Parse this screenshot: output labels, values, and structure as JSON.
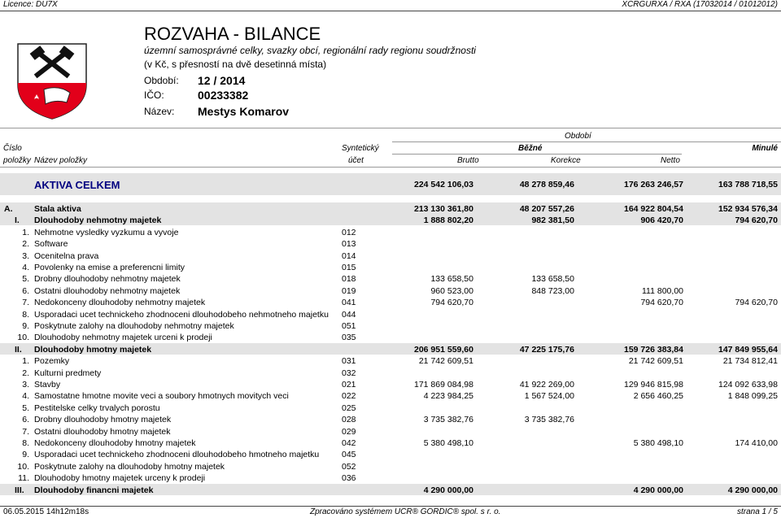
{
  "top": {
    "license": "Licence: DU7X",
    "report_code": "XCRGURXA / RXA (17032014 / 01012012)"
  },
  "header": {
    "title": "ROZVAHA - BILANCE",
    "subtitle": "územní samosprávné celky, svazky obcí, regionální rady regionu soudržnosti",
    "units_note": "(v Kč, s přesností na dvě desetinná místa)",
    "period_label": "Období:",
    "period_value": "12 / 2014",
    "ico_label": "IČO:",
    "ico_value": "00233382",
    "name_label": "Název:",
    "name_value": "Mestys Komarov"
  },
  "columns": {
    "cislo": "Číslo",
    "polozky": "položky",
    "nazev": "Název položky",
    "synteticky": "Syntetický",
    "ucet": "účet",
    "obdobi": "Období",
    "bezne": "Běžné",
    "minule": "Minulé",
    "brutto": "Brutto",
    "korekce": "Korekce",
    "netto": "Netto"
  },
  "total": {
    "label": "AKTIVA CELKEM",
    "brutto": "224 542 106,03",
    "korekce": "48 278 859,46",
    "netto": "176 263 246,57",
    "minule": "163 788 718,55"
  },
  "rows": [
    {
      "num": "A.",
      "name": "Stala aktiva",
      "acct": "",
      "brutto": "213 130 361,80",
      "korekce": "48 207 557,26",
      "netto": "164 922 804,54",
      "minule": "152 934 576,34",
      "bold": true,
      "level": 0
    },
    {
      "num": "I.",
      "name": "Dlouhodoby nehmotny majetek",
      "acct": "",
      "brutto": "1 888 802,20",
      "korekce": "982 381,50",
      "netto": "906 420,70",
      "minule": "794 620,70",
      "bold": true,
      "level": 1
    },
    {
      "num": "1.",
      "name": "Nehmotne vysledky vyzkumu a vyvoje",
      "acct": "012",
      "brutto": "",
      "korekce": "",
      "netto": "",
      "minule": "",
      "bold": false,
      "level": 2
    },
    {
      "num": "2.",
      "name": "Software",
      "acct": "013",
      "brutto": "",
      "korekce": "",
      "netto": "",
      "minule": "",
      "bold": false,
      "level": 2
    },
    {
      "num": "3.",
      "name": "Ocenitelna prava",
      "acct": "014",
      "brutto": "",
      "korekce": "",
      "netto": "",
      "minule": "",
      "bold": false,
      "level": 2
    },
    {
      "num": "4.",
      "name": "Povolenky na emise a preferencni limity",
      "acct": "015",
      "brutto": "",
      "korekce": "",
      "netto": "",
      "minule": "",
      "bold": false,
      "level": 2
    },
    {
      "num": "5.",
      "name": "Drobny dlouhodoby nehmotny majetek",
      "acct": "018",
      "brutto": "133 658,50",
      "korekce": "133 658,50",
      "netto": "",
      "minule": "",
      "bold": false,
      "level": 2
    },
    {
      "num": "6.",
      "name": "Ostatni dlouhodoby nehmotny majetek",
      "acct": "019",
      "brutto": "960 523,00",
      "korekce": "848 723,00",
      "netto": "111 800,00",
      "minule": "",
      "bold": false,
      "level": 2
    },
    {
      "num": "7.",
      "name": "Nedokonceny dlouhodoby nehmotny majetek",
      "acct": "041",
      "brutto": "794 620,70",
      "korekce": "",
      "netto": "794 620,70",
      "minule": "794 620,70",
      "bold": false,
      "level": 2
    },
    {
      "num": "8.",
      "name": "Usporadaci ucet technickeho zhodnoceni dlouhodobeho nehmotneho majetku",
      "acct": "044",
      "brutto": "",
      "korekce": "",
      "netto": "",
      "minule": "",
      "bold": false,
      "level": 2
    },
    {
      "num": "9.",
      "name": "Poskytnute zalohy na dlouhodoby nehmotny majetek",
      "acct": "051",
      "brutto": "",
      "korekce": "",
      "netto": "",
      "minule": "",
      "bold": false,
      "level": 2
    },
    {
      "num": "10.",
      "name": "Dlouhodoby nehmotny majetek urceni k prodeji",
      "acct": "035",
      "brutto": "",
      "korekce": "",
      "netto": "",
      "minule": "",
      "bold": false,
      "level": 2
    },
    {
      "num": "II.",
      "name": "Dlouhodoby hmotny majetek",
      "acct": "",
      "brutto": "206 951 559,60",
      "korekce": "47 225 175,76",
      "netto": "159 726 383,84",
      "minule": "147 849 955,64",
      "bold": true,
      "level": 1
    },
    {
      "num": "1.",
      "name": "Pozemky",
      "acct": "031",
      "brutto": "21 742 609,51",
      "korekce": "",
      "netto": "21 742 609,51",
      "minule": "21 734 812,41",
      "bold": false,
      "level": 2
    },
    {
      "num": "2.",
      "name": "Kulturni predmety",
      "acct": "032",
      "brutto": "",
      "korekce": "",
      "netto": "",
      "minule": "",
      "bold": false,
      "level": 2
    },
    {
      "num": "3.",
      "name": "Stavby",
      "acct": "021",
      "brutto": "171 869 084,98",
      "korekce": "41 922 269,00",
      "netto": "129 946 815,98",
      "minule": "124 092 633,98",
      "bold": false,
      "level": 2
    },
    {
      "num": "4.",
      "name": "Samostatne hmotne movite veci a soubory hmotnych movitych veci",
      "acct": "022",
      "brutto": "4 223 984,25",
      "korekce": "1 567 524,00",
      "netto": "2 656 460,25",
      "minule": "1 848 099,25",
      "bold": false,
      "level": 2
    },
    {
      "num": "5.",
      "name": "Pestitelske celky trvalych porostu",
      "acct": "025",
      "brutto": "",
      "korekce": "",
      "netto": "",
      "minule": "",
      "bold": false,
      "level": 2
    },
    {
      "num": "6.",
      "name": "Drobny dlouhodoby hmotny majetek",
      "acct": "028",
      "brutto": "3 735 382,76",
      "korekce": "3 735 382,76",
      "netto": "",
      "minule": "",
      "bold": false,
      "level": 2
    },
    {
      "num": "7.",
      "name": "Ostatni dlouhodoby hmotny majetek",
      "acct": "029",
      "brutto": "",
      "korekce": "",
      "netto": "",
      "minule": "",
      "bold": false,
      "level": 2
    },
    {
      "num": "8.",
      "name": "Nedokonceny dlouhodoby hmotny majetek",
      "acct": "042",
      "brutto": "5 380 498,10",
      "korekce": "",
      "netto": "5 380 498,10",
      "minule": "174 410,00",
      "bold": false,
      "level": 2
    },
    {
      "num": "9.",
      "name": "Usporadaci ucet technickeho zhodnoceni dlouhodobeho hmotneho majetku",
      "acct": "045",
      "brutto": "",
      "korekce": "",
      "netto": "",
      "minule": "",
      "bold": false,
      "level": 2
    },
    {
      "num": "10.",
      "name": "Poskytnute zalohy na dlouhodoby hmotny majetek",
      "acct": "052",
      "brutto": "",
      "korekce": "",
      "netto": "",
      "minule": "",
      "bold": false,
      "level": 2
    },
    {
      "num": "11.",
      "name": "Dlouhodoby hmotny majetek urceny k prodeji",
      "acct": "036",
      "brutto": "",
      "korekce": "",
      "netto": "",
      "minule": "",
      "bold": false,
      "level": 2
    },
    {
      "num": "III.",
      "name": "Dlouhodoby financni majetek",
      "acct": "",
      "brutto": "4 290 000,00",
      "korekce": "",
      "netto": "4 290 000,00",
      "minule": "4 290 000,00",
      "bold": true,
      "level": 1
    }
  ],
  "footer": {
    "timestamp": "06.05.2015 14h12m18s",
    "system": "Zpracováno systémem UCR® GORDIC® spol. s r. o.",
    "page": "strana 1 / 5"
  },
  "colors": {
    "total_label": "#000080",
    "band": "#e3e3e3",
    "coat_red": "#e2001a"
  }
}
